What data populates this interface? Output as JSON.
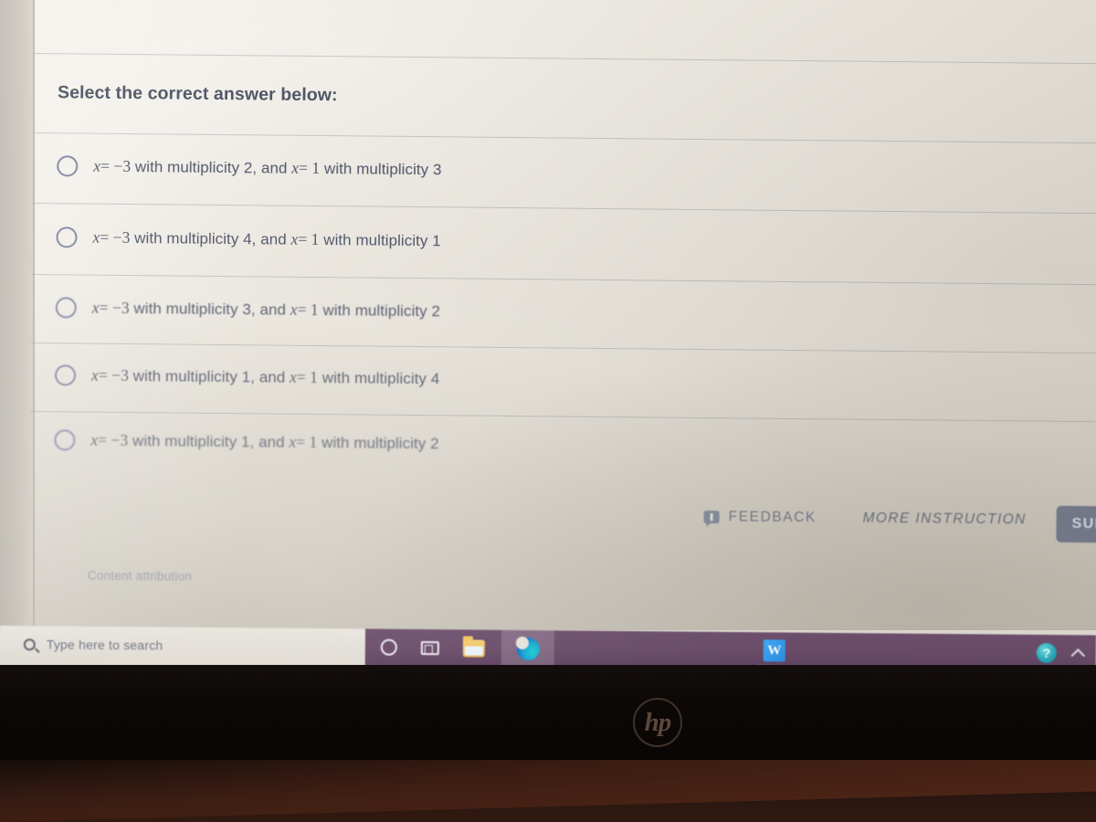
{
  "question": {
    "prompt": "Select the correct answer below:",
    "options": [
      {
        "id": "option-a",
        "text": "x = −3 with multiplicity 2, and x = 1 with multiplicity 3",
        "var1": "x",
        "eq1": "= −3",
        "mid": " with multiplicity 2, and ",
        "var2": "x",
        "eq2": "= 1",
        "tail": " with multiplicity 3",
        "selected": false
      },
      {
        "id": "option-b",
        "text": "x = −3 with multiplicity 4, and x = 1 with multiplicity 1",
        "var1": "x",
        "eq1": "= −3",
        "mid": " with multiplicity 4, and ",
        "var2": "x",
        "eq2": "= 1",
        "tail": " with multiplicity 1",
        "selected": false
      },
      {
        "id": "option-c",
        "text": "x = −3 with multiplicity 3, and x = 1 with multiplicity 2",
        "var1": "x",
        "eq1": "= −3",
        "mid": " with multiplicity 3, and ",
        "var2": "x",
        "eq2": "= 1",
        "tail": " with multiplicity 2",
        "selected": false
      },
      {
        "id": "option-d",
        "text": "x = −3 with multiplicity 1, and x = 1 with multiplicity 4",
        "var1": "x",
        "eq1": "= −3",
        "mid": " with multiplicity 1, and ",
        "var2": "x",
        "eq2": "= 1",
        "tail": " with multiplicity 4",
        "selected": false
      },
      {
        "id": "option-e",
        "text": "x = −3 with multiplicity 1, and x = 1 with multiplicity 2",
        "var1": "x",
        "eq1": "= −3",
        "mid": " with multiplicity 1, and ",
        "var2": "x",
        "eq2": "= 1",
        "tail": " with multiplicity 2",
        "selected": false
      }
    ]
  },
  "footer": {
    "feedback_label": "FEEDBACK",
    "feedback_icon": "speech-bubble-icon",
    "more_instruction_label": "MORE INSTRUCTION",
    "submit_label": "SUBMIT",
    "attribution": "Content attribution"
  },
  "taskbar": {
    "search_placeholder": "Type here to search",
    "search_icon": "search-icon",
    "items": [
      {
        "name": "cortana-icon",
        "label": "Cortana"
      },
      {
        "name": "task-view-icon",
        "label": "Task View"
      },
      {
        "name": "file-explorer-icon",
        "label": "File Explorer"
      },
      {
        "name": "microsoft-edge-icon",
        "label": "Microsoft Edge"
      },
      {
        "name": "microsoft-word-icon",
        "label": "W"
      }
    ],
    "tray": [
      {
        "name": "help-icon",
        "label": "?"
      },
      {
        "name": "chevron-up-icon",
        "label": "Show hidden icons"
      }
    ]
  },
  "device": {
    "brand_logo": "hp"
  },
  "colors": {
    "accent": "#6d7488",
    "text": "#4f566a",
    "taskbar": "#6a4c69",
    "page": "#eeeae2"
  }
}
